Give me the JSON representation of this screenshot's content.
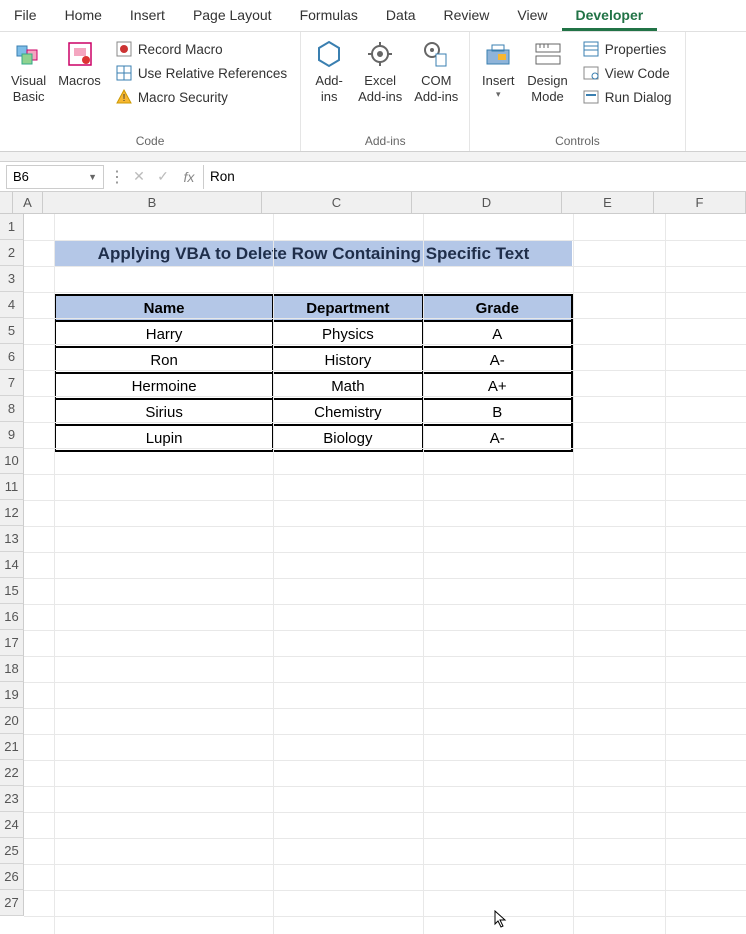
{
  "tabs": {
    "file": "File",
    "home": "Home",
    "insert": "Insert",
    "page_layout": "Page Layout",
    "formulas": "Formulas",
    "data": "Data",
    "review": "Review",
    "view": "View",
    "developer": "Developer"
  },
  "ribbon": {
    "code": {
      "visual_basic": "Visual\nBasic",
      "macros": "Macros",
      "record_macro": "Record Macro",
      "relative_refs": "Use Relative References",
      "macro_security": "Macro Security",
      "group": "Code"
    },
    "addins": {
      "addins": "Add-\nins",
      "excel_addins": "Excel\nAdd-ins",
      "com_addins": "COM\nAdd-ins",
      "group": "Add-ins"
    },
    "controls": {
      "insert": "Insert",
      "design_mode": "Design\nMode",
      "properties": "Properties",
      "view_code": "View Code",
      "run_dialog": "Run Dialog",
      "group": "Controls"
    }
  },
  "namebox": {
    "cell": "B6",
    "formula": "Ron"
  },
  "columns": [
    "A",
    "B",
    "C",
    "D",
    "E",
    "F"
  ],
  "rows": [
    "1",
    "2",
    "3",
    "4",
    "5",
    "6",
    "7",
    "8",
    "9",
    "10",
    "11",
    "12",
    "13",
    "14",
    "15",
    "16",
    "17",
    "18",
    "19",
    "20",
    "21",
    "22",
    "23",
    "24",
    "25",
    "26",
    "27"
  ],
  "title": "Applying VBA to Delete Row Containing Specific Text",
  "table": {
    "headers": [
      "Name",
      "Department",
      "Grade"
    ],
    "data": [
      [
        "Harry",
        "Physics",
        "A"
      ],
      [
        "Ron",
        "History",
        "A-"
      ],
      [
        "Hermoine",
        "Math",
        "A+"
      ],
      [
        "Sirius",
        "Chemistry",
        "B"
      ],
      [
        "Lupin",
        "Biology",
        "A-"
      ]
    ]
  }
}
